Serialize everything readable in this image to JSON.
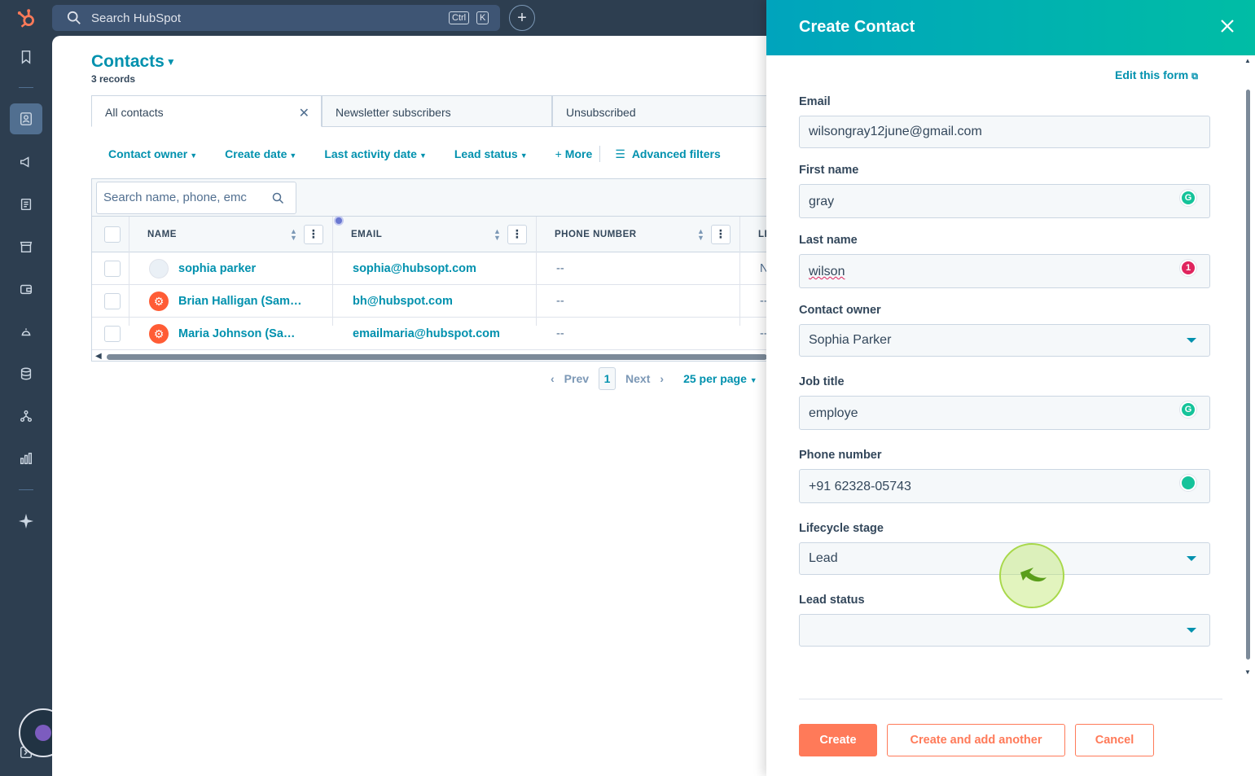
{
  "topbar": {
    "search_placeholder": "Search HubSpot",
    "shortcut_ctrl": "Ctrl",
    "shortcut_key": "K",
    "add_symbol": "+"
  },
  "nav": {
    "logo": "hubspot-logo"
  },
  "contacts": {
    "title": "Contacts",
    "records": "3 records",
    "tabs": [
      {
        "label": "All contacts"
      },
      {
        "label": "Newsletter subscribers"
      },
      {
        "label": "Unsubscribed"
      }
    ],
    "filters": {
      "contact_owner": "Contact owner",
      "create_date": "Create date",
      "last_activity": "Last activity date",
      "lead_status": "Lead status",
      "more": "More",
      "advanced": "Advanced filters"
    },
    "table_search_placeholder": "Search name, phone, emc",
    "columns": {
      "name": "NAME",
      "email": "EMAIL",
      "phone": "PHONE NUMBER",
      "next": "LI"
    },
    "rows": [
      {
        "name": "sophia parker",
        "email": "sophia@hubsopt.com",
        "phone": "--",
        "extra": "N"
      },
      {
        "name": "Brian Halligan (Sam…",
        "email": "bh@hubspot.com",
        "phone": "--",
        "extra": "--"
      },
      {
        "name": "Maria Johnson (Sa…",
        "email": "emailmaria@hubspot.com",
        "phone": "--",
        "extra": "--"
      }
    ],
    "pager": {
      "prev": "Prev",
      "page": "1",
      "next": "Next",
      "per_page": "25 per page"
    }
  },
  "panel": {
    "title": "Create Contact",
    "edit_form": "Edit this form",
    "fields": {
      "email_label": "Email",
      "email_value": "wilsongray12june@gmail.com",
      "first_name_label": "First name",
      "first_name_value": "gray",
      "last_name_label": "Last name",
      "last_name_value": "wilson",
      "last_name_badge": "1",
      "owner_label": "Contact owner",
      "owner_value": "Sophia Parker",
      "job_label": "Job title",
      "job_value": "employe",
      "phone_label": "Phone number",
      "phone_value": "+91 62328-05743",
      "lifecycle_label": "Lifecycle stage",
      "lifecycle_value": "Lead",
      "lead_status_label": "Lead status",
      "lead_status_value": ""
    },
    "buttons": {
      "create": "Create",
      "create_another": "Create and add another",
      "cancel": "Cancel"
    }
  },
  "colors": {
    "nav_bg": "#2d3e50",
    "accent_teal": "#0091ae",
    "header_gradient_start": "#00a4bd",
    "header_gradient_end": "#00bda5",
    "primary_orange": "#ff7a59"
  }
}
